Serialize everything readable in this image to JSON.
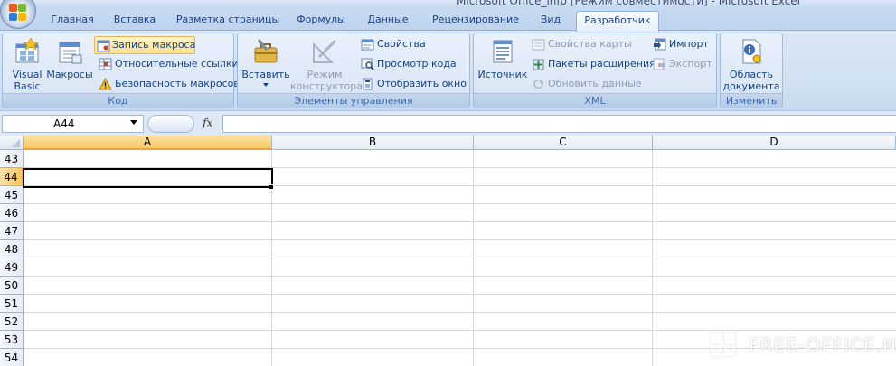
{
  "window": {
    "title": "Microsoft Office_info   [Режим совместимости] - Microsoft Excel"
  },
  "tabs": [
    {
      "label": "Главная"
    },
    {
      "label": "Вставка"
    },
    {
      "label": "Разметка страницы"
    },
    {
      "label": "Формулы"
    },
    {
      "label": "Данные"
    },
    {
      "label": "Рецензирование"
    },
    {
      "label": "Вид"
    },
    {
      "label": "Разработчик",
      "active": true
    }
  ],
  "ribbon": {
    "code": {
      "label": "Код",
      "visual_basic": "Visual Basic",
      "macros": "Макросы",
      "record_macro": "Запись макроса",
      "relative_refs": "Относительные ссылки",
      "macro_security": "Безопасность макросов"
    },
    "controls": {
      "label": "Элементы управления",
      "insert": "Вставить",
      "design_mode": "Режим конструктора",
      "properties": "Свойства",
      "view_code": "Просмотр кода",
      "run_dialog": "Отобразить окно"
    },
    "xml": {
      "label": "XML",
      "source": "Источник",
      "map_properties": "Свойства карты",
      "expansion_packs": "Пакеты расширения",
      "refresh_data": "Обновить данные",
      "import": "Импорт",
      "export": "Экспорт"
    },
    "modify": {
      "label": "Изменить",
      "document_panel": "Область документа"
    }
  },
  "formula_bar": {
    "name_box": "A44",
    "fx_label": "fx",
    "formula": ""
  },
  "sheet": {
    "columns": [
      "A",
      "B",
      "C",
      "D"
    ],
    "selected_column": "A",
    "rows": [
      "43",
      "44",
      "45",
      "46",
      "47",
      "48",
      "49",
      "50",
      "51",
      "52",
      "53",
      "54"
    ],
    "selected_row": "44",
    "active_cell": "A44"
  },
  "watermark": {
    "text": "FREE-OFFICE.NET"
  },
  "colors": {
    "ribbon_text": "#15428b",
    "selected_header": "#f6c861",
    "grid_line": "#d0d7e5"
  }
}
